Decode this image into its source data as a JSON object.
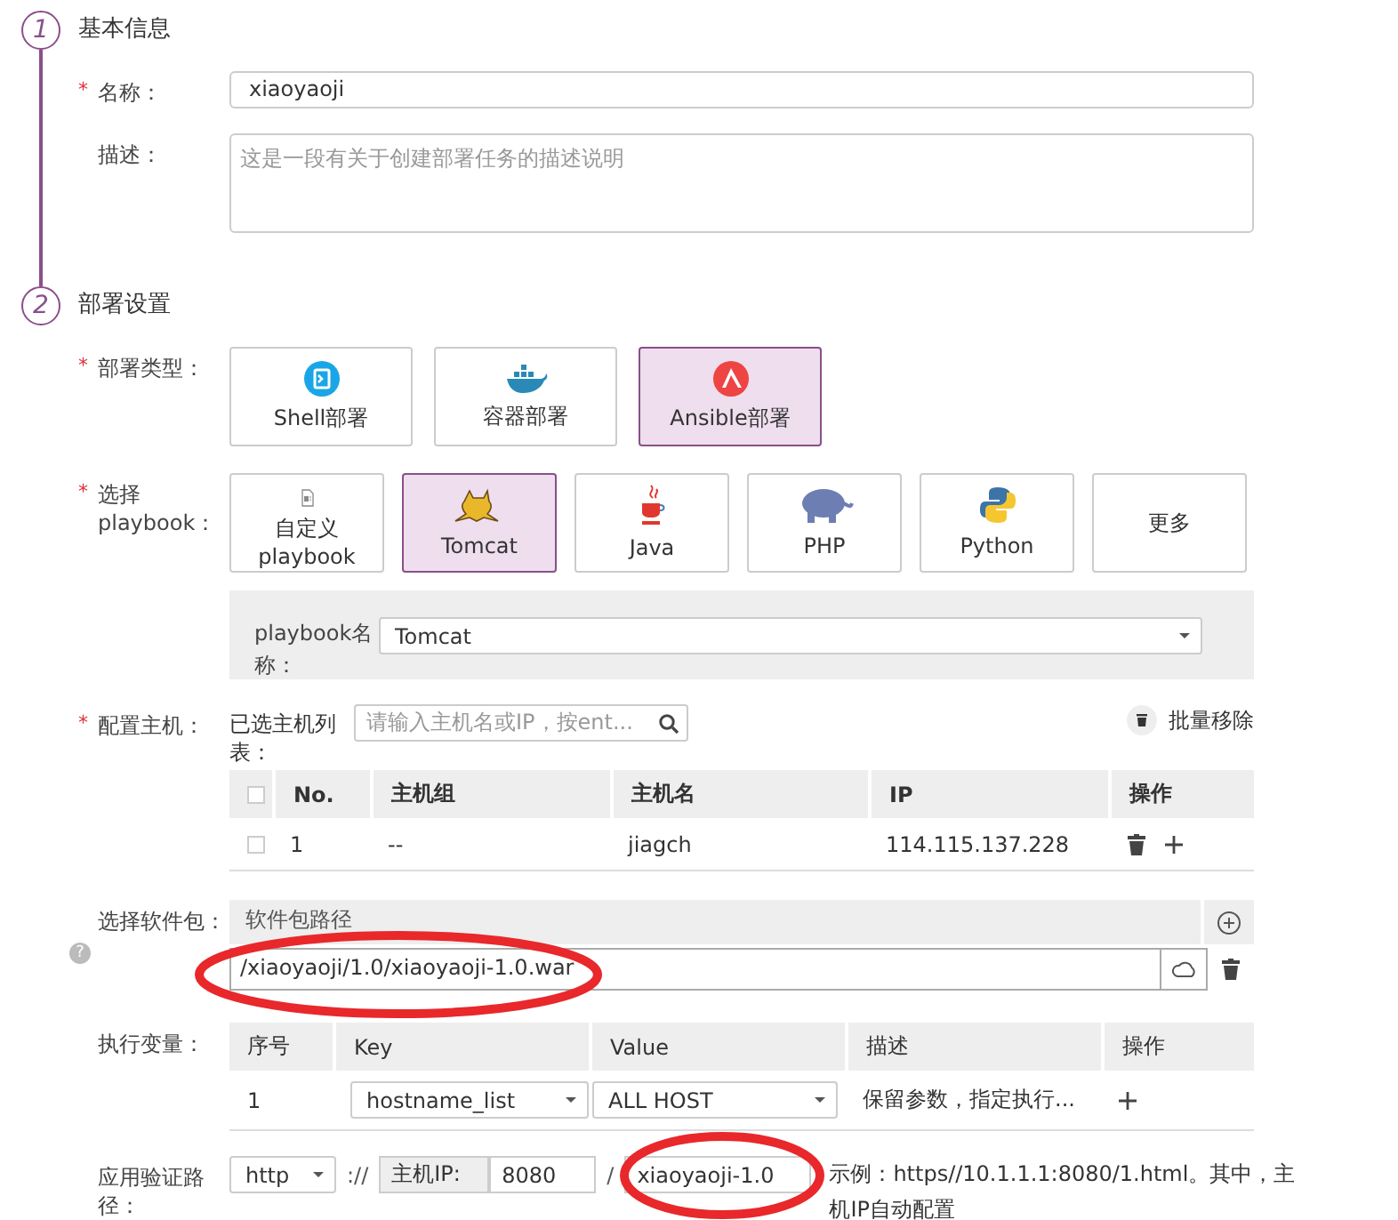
{
  "required_mark": "*",
  "steps": [
    {
      "number": "1",
      "title": "基本信息"
    },
    {
      "number": "2",
      "title": "部署设置"
    }
  ],
  "basic": {
    "name": {
      "label": "名称：",
      "required": true,
      "value": "xiaoyaoji"
    },
    "description": {
      "label": "描述：",
      "placeholder": "这是一段有关于创建部署任务的描述说明"
    }
  },
  "deploy_type": {
    "label": "部署类型：",
    "required": true,
    "options": [
      {
        "kind": "shell",
        "label": "Shell部署",
        "selected": false
      },
      {
        "kind": "container",
        "label": "容器部署",
        "selected": false
      },
      {
        "kind": "ansible",
        "label": "Ansible部署",
        "selected": true
      }
    ]
  },
  "playbook": {
    "label": "选择 playbook：",
    "required": true,
    "options": [
      {
        "kind": "custom",
        "label": "自定义playbook",
        "selected": false
      },
      {
        "kind": "tomcat",
        "label": "Tomcat",
        "selected": true
      },
      {
        "kind": "java",
        "label": "Java",
        "selected": false
      },
      {
        "kind": "php",
        "label": "PHP",
        "selected": false
      },
      {
        "kind": "python",
        "label": "Python",
        "selected": false
      },
      {
        "kind": "more",
        "label": "更多",
        "selected": false
      }
    ],
    "name_label": "playbook名称：",
    "name_value": "Tomcat"
  },
  "hosts": {
    "label": "配置主机：",
    "required": true,
    "list_label": "已选主机列表：",
    "search_placeholder": "请输入主机名或IP，按ent...",
    "remove_button": "批量移除",
    "all_checked": false,
    "columns": [
      "No.",
      "主机组",
      "主机名",
      "IP",
      "操作"
    ],
    "rows": [
      {
        "checked": false,
        "no": "1",
        "group": "--",
        "host": "jiagch",
        "ip": "114.115.137.228"
      }
    ]
  },
  "package": {
    "label": "选择软件包：",
    "help": "?",
    "column": "软件包路径",
    "path": "/xiaoyaoji/1.0/xiaoyaoji-1.0.war",
    "circled": true
  },
  "variables": {
    "label": "执行变量：",
    "columns": [
      "序号",
      "Key",
      "Value",
      "描述",
      "操作"
    ],
    "rows": [
      {
        "no": "1",
        "key": "hostname_list",
        "value": "ALL HOST",
        "description": "保留参数，指定执行..."
      }
    ]
  },
  "verify": {
    "label": "应用验证路径：",
    "protocol": "http",
    "separator": "://",
    "host_label": "主机IP:",
    "port": "8080",
    "slash": "/",
    "path": "xiaoyaoji-1.0",
    "circled": true,
    "example": "示例：https//10.1.1.1:8080/1.html。其中，主机IP自动配置"
  }
}
